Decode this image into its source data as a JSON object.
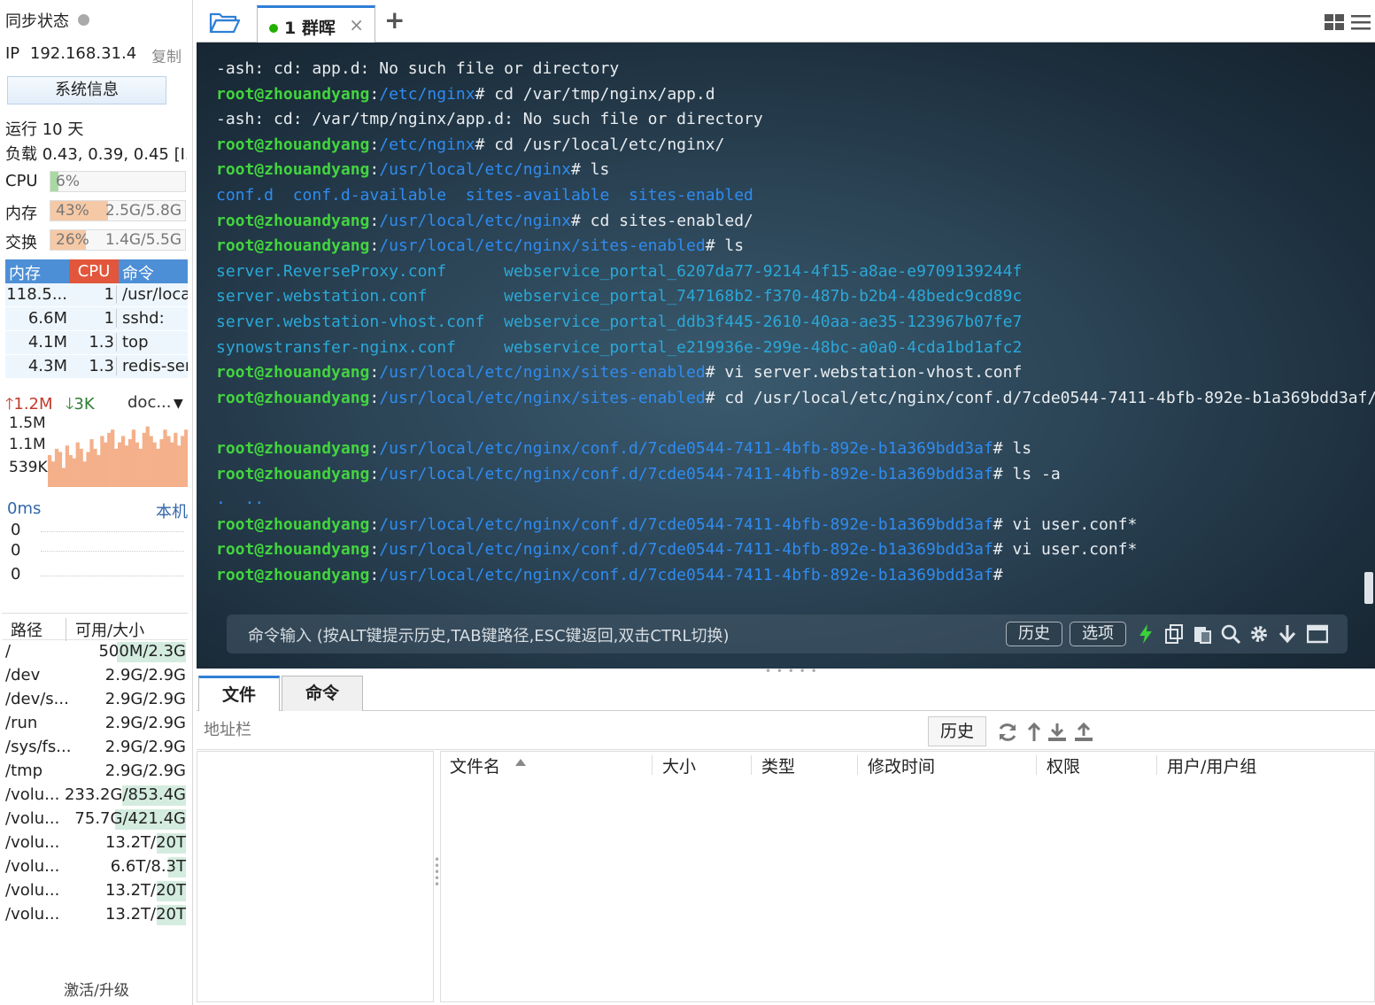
{
  "sidebar": {
    "sync_status": "同步状态",
    "ip_label": "IP",
    "ip": "192.168.31.4",
    "copy_label": "复制",
    "sysinfo_button": "系统信息",
    "uptime": "运行 10 天",
    "load": "负载 0.43, 0.39, 0.45 [I...",
    "cpu": {
      "label": "CPU",
      "percent_text": "6%",
      "percent": 6,
      "color": "#a8d9a3"
    },
    "mem": {
      "label": "内存",
      "percent_text": "43%",
      "percent": 43,
      "size": "2.5G/5.8G",
      "color": "#f6c9a6"
    },
    "swap": {
      "label": "交换",
      "percent_text": "26%",
      "percent": 26,
      "size": "1.4G/5.5G",
      "color": "#f6c9a6"
    },
    "proc_headers": {
      "mem": "内存",
      "cpu": "CPU",
      "cmd": "命令"
    },
    "procs": [
      {
        "mem": "118.5...",
        "cpu": "1",
        "cmd": "/usr/loca"
      },
      {
        "mem": "6.6M",
        "cpu": "1",
        "cmd": "sshd:"
      },
      {
        "mem": "4.1M",
        "cpu": "1.3",
        "cmd": "top"
      },
      {
        "mem": "4.3M",
        "cpu": "1.3",
        "cmd": "redis-ser"
      }
    ],
    "net": {
      "up": "1.2M",
      "down": "3K",
      "iface": "doc...",
      "axis": [
        "1.5M",
        "1.1M",
        "539K"
      ],
      "samples": [
        0.5,
        0.4,
        0.6,
        0.55,
        0.3,
        0.65,
        0.5,
        0.45,
        0.7,
        0.6,
        0.4,
        0.55,
        0.75,
        0.6,
        0.5,
        0.8,
        0.7,
        0.85,
        0.9,
        0.6,
        0.7,
        0.8,
        0.65,
        0.75,
        0.9,
        0.7,
        0.6,
        0.85,
        0.95,
        0.8,
        0.7,
        0.6,
        0.75,
        0.9,
        0.8,
        0.7,
        0.85,
        0.65,
        0.8,
        0.9
      ],
      "color_up": "#f4b08a"
    },
    "ping": {
      "ms": "0ms",
      "host": "本机",
      "values": [
        "0",
        "0",
        "0"
      ]
    },
    "disk_headers": {
      "path": "路径",
      "size": "可用/大小"
    },
    "disks": [
      {
        "path": "/",
        "size": "500M/2.3G",
        "used": 0.8
      },
      {
        "path": "/dev",
        "size": "2.9G/2.9G",
        "used": 0
      },
      {
        "path": "/dev/s...",
        "size": "2.9G/2.9G",
        "used": 0
      },
      {
        "path": "/run",
        "size": "2.9G/2.9G",
        "used": 0
      },
      {
        "path": "/sys/fs...",
        "size": "2.9G/2.9G",
        "used": 0
      },
      {
        "path": "/tmp",
        "size": "2.9G/2.9G",
        "used": 0
      },
      {
        "path": "/volu...",
        "size": "233.2G/853.4G",
        "used": 0.73
      },
      {
        "path": "/volu...",
        "size": "75.7G/421.4G",
        "used": 0.82
      },
      {
        "path": "/volu...",
        "size": "13.2T/20T",
        "used": 0.34
      },
      {
        "path": "/volu...",
        "size": "6.6T/8.3T",
        "used": 0.2
      },
      {
        "path": "/volu...",
        "size": "13.2T/20T",
        "used": 0.34
      },
      {
        "path": "/volu...",
        "size": "13.2T/20T",
        "used": 0.34
      }
    ],
    "activate": "激活/升级"
  },
  "tabs": {
    "active_label": "1 群晖",
    "close": "×",
    "new": "+"
  },
  "terminal": {
    "lines": [
      [
        {
          "t": "-ash: cd: app.d: No such file or directory"
        }
      ],
      [
        {
          "t": "root@zhouandyang",
          "c": "u"
        },
        {
          "t": ":"
        },
        {
          "t": "/etc/nginx",
          "c": "p"
        },
        {
          "t": "# cd /var/tmp/nginx/app.d"
        }
      ],
      [
        {
          "t": "-ash: cd: /var/tmp/nginx/app.d: No such file or directory"
        }
      ],
      [
        {
          "t": "root@zhouandyang",
          "c": "u"
        },
        {
          "t": ":"
        },
        {
          "t": "/etc/nginx",
          "c": "p"
        },
        {
          "t": "# cd /usr/local/etc/nginx/"
        }
      ],
      [
        {
          "t": "root@zhouandyang",
          "c": "u"
        },
        {
          "t": ":"
        },
        {
          "t": "/usr/local/etc/nginx",
          "c": "p"
        },
        {
          "t": "# ls"
        }
      ],
      [
        {
          "t": "conf.d  conf.d-available  sites-available  sites-enabled",
          "c": "d"
        }
      ],
      [
        {
          "t": "root@zhouandyang",
          "c": "u"
        },
        {
          "t": ":"
        },
        {
          "t": "/usr/local/etc/nginx",
          "c": "p"
        },
        {
          "t": "# cd sites-enabled/"
        }
      ],
      [
        {
          "t": "root@zhouandyang",
          "c": "u"
        },
        {
          "t": ":"
        },
        {
          "t": "/usr/local/etc/nginx/sites-enabled",
          "c": "p"
        },
        {
          "t": "# ls"
        }
      ],
      [
        {
          "t": "server.ReverseProxy.conf      webservice_portal_6207da77-9214-4f15-a8ae-e9709139244f",
          "c": "f"
        }
      ],
      [
        {
          "t": "server.webstation.conf        webservice_portal_747168b2-f370-487b-b2b4-48bedc9cd89c",
          "c": "f"
        }
      ],
      [
        {
          "t": "server.webstation-vhost.conf  webservice_portal_ddb3f445-2610-40aa-ae35-123967b07fe7",
          "c": "f"
        }
      ],
      [
        {
          "t": "synowstransfer-nginx.conf     webservice_portal_e219936e-299e-48bc-a0a0-4cda1bd1afc2",
          "c": "f"
        }
      ],
      [
        {
          "t": "root@zhouandyang",
          "c": "u"
        },
        {
          "t": ":"
        },
        {
          "t": "/usr/local/etc/nginx/sites-enabled",
          "c": "p"
        },
        {
          "t": "# vi server.webstation-vhost.conf"
        }
      ],
      [
        {
          "t": "root@zhouandyang",
          "c": "u"
        },
        {
          "t": ":"
        },
        {
          "t": "/usr/local/etc/nginx/sites-enabled",
          "c": "p"
        },
        {
          "t": "# cd /usr/local/etc/nginx/conf.d/7cde0544-7411-4bfb-892e-b1a369bdd3af/"
        }
      ],
      [
        {
          "t": " "
        }
      ],
      [
        {
          "t": "root@zhouandyang",
          "c": "u"
        },
        {
          "t": ":"
        },
        {
          "t": "/usr/local/etc/nginx/conf.d/7cde0544-7411-4bfb-892e-b1a369bdd3af",
          "c": "p"
        },
        {
          "t": "# ls"
        }
      ],
      [
        {
          "t": "root@zhouandyang",
          "c": "u"
        },
        {
          "t": ":"
        },
        {
          "t": "/usr/local/etc/nginx/conf.d/7cde0544-7411-4bfb-892e-b1a369bdd3af",
          "c": "p"
        },
        {
          "t": "# ls -a"
        }
      ],
      [
        {
          "t": ".  ..",
          "c": "d"
        }
      ],
      [
        {
          "t": "root@zhouandyang",
          "c": "u"
        },
        {
          "t": ":"
        },
        {
          "t": "/usr/local/etc/nginx/conf.d/7cde0544-7411-4bfb-892e-b1a369bdd3af",
          "c": "p"
        },
        {
          "t": "# vi user.conf*"
        }
      ],
      [
        {
          "t": "root@zhouandyang",
          "c": "u"
        },
        {
          "t": ":"
        },
        {
          "t": "/usr/local/etc/nginx/conf.d/7cde0544-7411-4bfb-892e-b1a369bdd3af",
          "c": "p"
        },
        {
          "t": "# vi user.conf*"
        }
      ],
      [
        {
          "t": "root@zhouandyang",
          "c": "u"
        },
        {
          "t": ":"
        },
        {
          "t": "/usr/local/etc/nginx/conf.d/7cde0544-7411-4bfb-892e-b1a369bdd3af",
          "c": "p"
        },
        {
          "t": "#"
        }
      ]
    ],
    "cmd_placeholder": "命令输入 (按ALT键提示历史,TAB键路径,ESC键返回,双击CTRL切换)",
    "history_button": "历史",
    "options_button": "选项"
  },
  "files": {
    "tab_files": "文件",
    "tab_commands": "命令",
    "address_placeholder": "地址栏",
    "history_button": "历史",
    "columns": [
      "文件名",
      "大小",
      "类型",
      "修改时间",
      "权限",
      "用户/用户组"
    ]
  },
  "colors": {
    "accent": "#2f7fd6",
    "prompt_user": "#43d43f",
    "prompt_path": "#2f8cf0"
  }
}
